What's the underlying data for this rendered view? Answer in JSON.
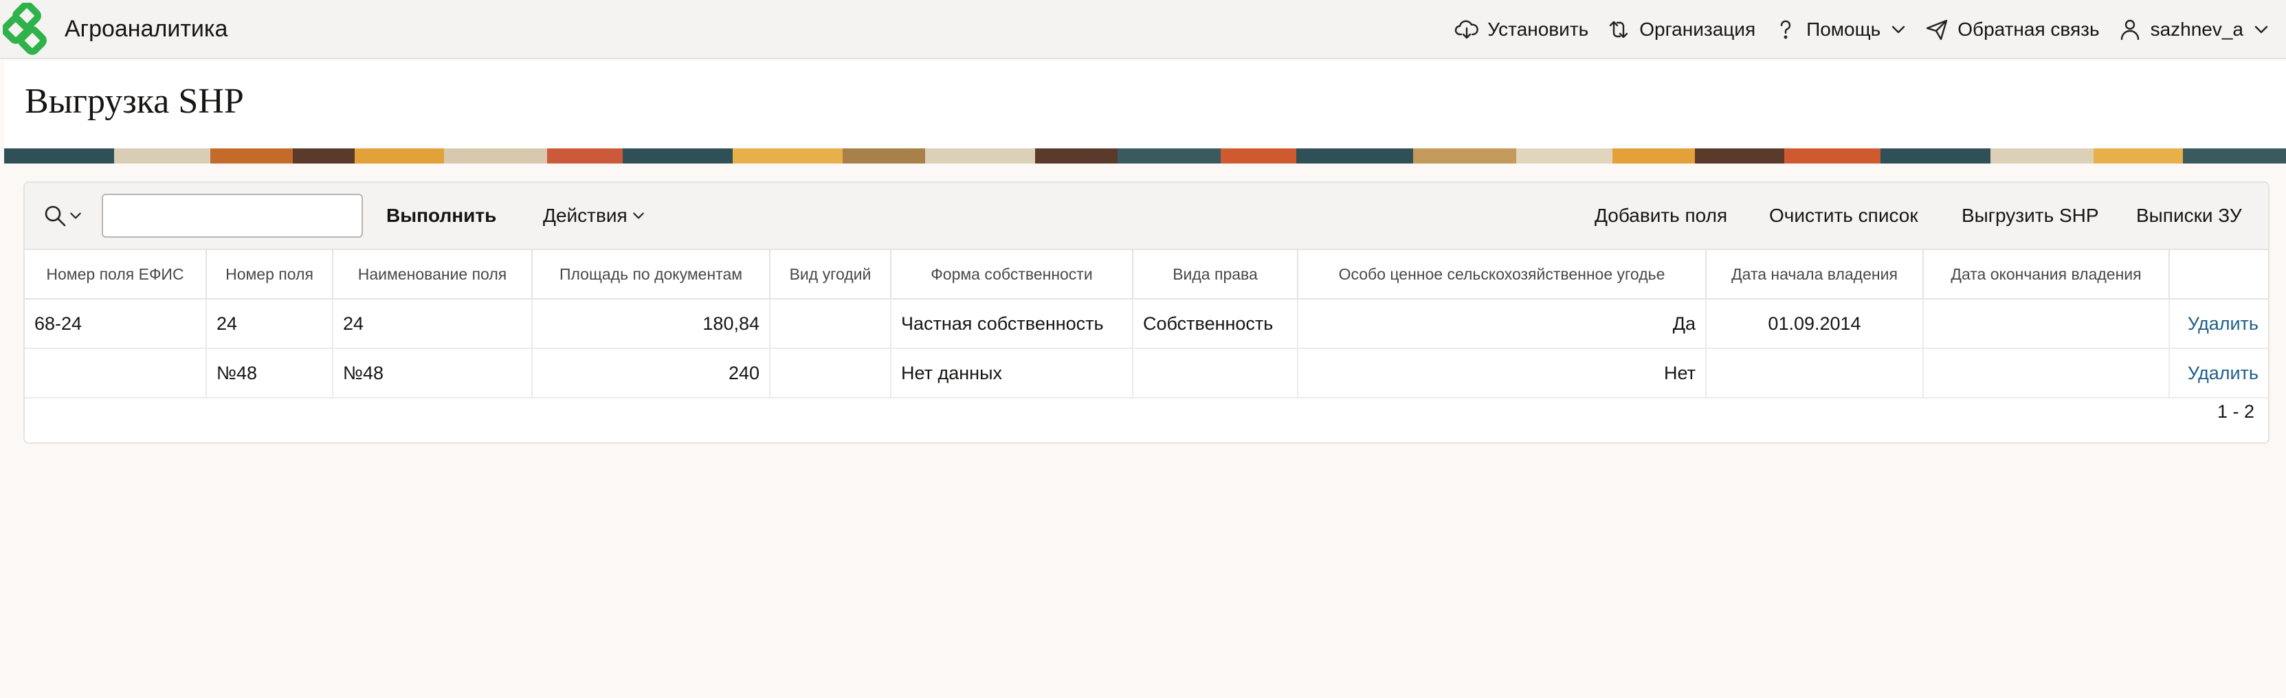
{
  "app": {
    "name": "Агроаналитика"
  },
  "nav": {
    "install": "Установить",
    "organization": "Организация",
    "help": "Помощь",
    "feedback": "Обратная связь",
    "user": "sazhnev_a"
  },
  "page": {
    "title": "Выгрузка SHP"
  },
  "toolbar": {
    "search_value": "",
    "run": "Выполнить",
    "actions": "Действия",
    "add_fields": "Добавить поля",
    "clear_list": "Очистить список",
    "export_shp": "Выгрузить SHP",
    "extracts": "Выписки ЗУ"
  },
  "table": {
    "headers": [
      "Номер поля ЕФИС",
      "Номер поля",
      "Наименование поля",
      "Площадь по документам",
      "Вид угодий",
      "Форма собственности",
      "Вида права",
      "Особо ценное сельскохозяйственное угодье",
      "Дата начала владения",
      "Дата окончания владения",
      ""
    ],
    "rows": [
      {
        "efis": "68-24",
        "num": "24",
        "name": "24",
        "area": "180,84",
        "land_type": "",
        "ownership": "Частная собственность",
        "right": "Собственность",
        "valuable": "Да",
        "start": "01.09.2014",
        "end": "",
        "action": "Удалить"
      },
      {
        "efis": "",
        "num": "№48",
        "name": "№48",
        "area": "240",
        "land_type": "",
        "ownership": "Нет данных",
        "right": "",
        "valuable": "Нет",
        "start": "",
        "end": "",
        "action": "Удалить"
      }
    ]
  },
  "pagination": "1 - 2",
  "icons": {
    "logo": "agroanalytics-logo",
    "install": "cloud-download-icon",
    "organization": "swap-arrows-icon",
    "help": "question-icon",
    "feedback": "paper-plane-icon",
    "user": "user-icon",
    "search": "search-icon"
  },
  "colors": {
    "brand_green": "#2fb24a",
    "link": "#1f5f8b"
  }
}
